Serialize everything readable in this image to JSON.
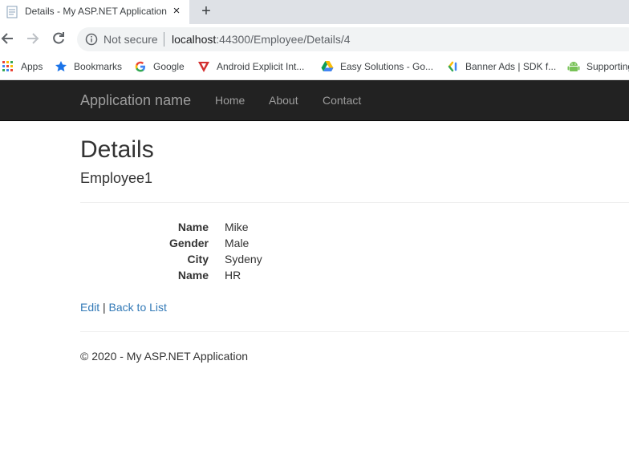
{
  "browser": {
    "tab_title": "Details - My ASP.NET Application",
    "tab_close": "×",
    "new_tab": "+",
    "not_secure": "Not secure",
    "url_host": "localhost",
    "url_path": ":44300/Employee/Details/4",
    "bookmarks": [
      {
        "label": "Apps",
        "icon": "apps-grid-icon"
      },
      {
        "label": "Bookmarks",
        "icon": "star-icon"
      },
      {
        "label": "Google",
        "icon": "google-icon"
      },
      {
        "label": "Android Explicit Int...",
        "icon": "android-intent-icon"
      },
      {
        "label": "Easy Solutions - Go...",
        "icon": "google-drive-icon"
      },
      {
        "label": "Banner Ads  |  SDK f...",
        "icon": "ads-icon"
      },
      {
        "label": "Supporting",
        "icon": "android-icon"
      }
    ]
  },
  "navbar": {
    "brand": "Application name",
    "links": [
      "Home",
      "About",
      "Contact"
    ]
  },
  "page": {
    "title": "Details",
    "subtitle": "Employee1",
    "fields": [
      {
        "label": "Name",
        "value": "Mike"
      },
      {
        "label": "Gender",
        "value": "Male"
      },
      {
        "label": "City",
        "value": "Sydeny"
      },
      {
        "label": "Name",
        "value": "HR"
      }
    ],
    "edit_link": "Edit",
    "separator": "|",
    "back_link": "Back to List",
    "footer": "© 2020 - My ASP.NET Application"
  },
  "colors": {
    "navbar_bg": "#222222",
    "nav_text": "#9d9d9d",
    "link": "#337ab7"
  }
}
